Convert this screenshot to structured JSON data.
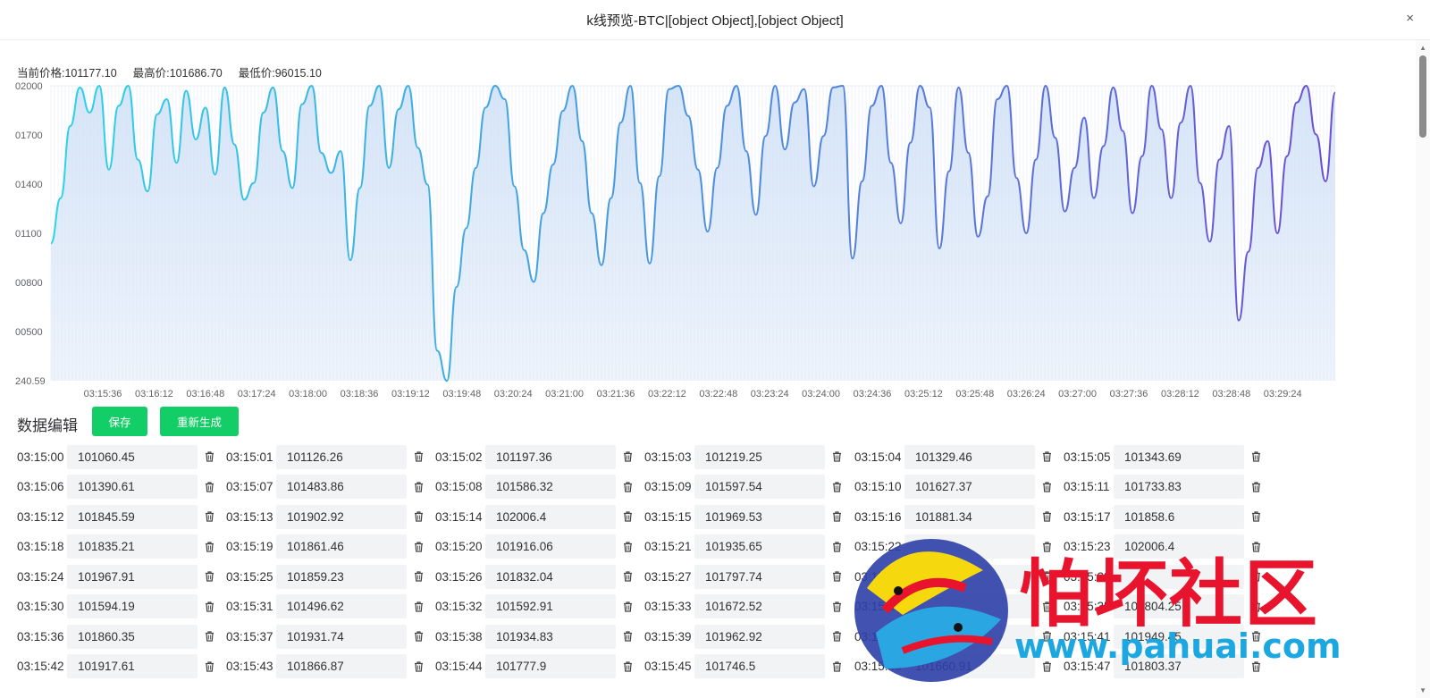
{
  "window": {
    "title": "k线预览-BTC|[object Object],[object Object]",
    "close_label": "×"
  },
  "stats": [
    {
      "label": "当前价格:",
      "value": "101177.10"
    },
    {
      "label": "最高价:",
      "value": "101686.70"
    },
    {
      "label": "最低价:",
      "value": "96015.10"
    }
  ],
  "chart_data": {
    "type": "area",
    "y_ticks": [
      "02000",
      "01700",
      "01400",
      "01100",
      "00800",
      "00500",
      "240.59"
    ],
    "ylim": [
      100240.59,
      102000
    ],
    "x_ticks": [
      "03:15:36",
      "03:16:12",
      "03:16:48",
      "03:17:24",
      "03:18:00",
      "03:18:36",
      "03:19:12",
      "03:19:48",
      "03:20:24",
      "03:21:00",
      "03:21:36",
      "03:22:12",
      "03:22:48",
      "03:23:24",
      "03:24:00",
      "03:24:36",
      "03:25:12",
      "03:25:48",
      "03:26:24",
      "03:27:00",
      "03:27:36",
      "03:28:12",
      "03:28:48",
      "03:29:24"
    ],
    "xlim": [
      "03:15:00",
      "03:29:59"
    ],
    "grid": true,
    "colors": {
      "start": "#2bd4e8",
      "end": "#6b4fd8",
      "fill": "#cfe0f6"
    },
    "series": [
      {
        "values": [
          101060,
          101330,
          101760,
          101990,
          101840,
          102000,
          101500,
          101880,
          102000,
          101560,
          101370,
          101830,
          101920,
          101540,
          101970,
          101680,
          101870,
          101470,
          101990,
          101650,
          101320,
          101420,
          101840,
          101990,
          101610,
          101390,
          101890,
          102000,
          101600,
          101480,
          101610,
          100960,
          101390,
          101880,
          102000,
          101510,
          101860,
          102000,
          101630,
          101410,
          100420,
          100240,
          100800,
          101150,
          101510,
          101870,
          102000,
          101920,
          101400,
          101020,
          100830,
          101240,
          101530,
          101850,
          102000,
          101670,
          101240,
          100930,
          101330,
          101780,
          102000,
          101420,
          100940,
          101460,
          101980,
          102000,
          101820,
          101500,
          101130,
          101510,
          101880,
          102000,
          101610,
          101230,
          101700,
          102000,
          101620,
          101900,
          101980,
          101400,
          101700,
          101990,
          102000,
          100970,
          101430,
          101880,
          102000,
          101540,
          101180,
          101660,
          102000,
          101870,
          101030,
          101490,
          101990,
          101600,
          101100,
          101340,
          101920,
          102000,
          101450,
          101120,
          101560,
          102000,
          101690,
          101250,
          101510,
          101810,
          101330,
          101640,
          101990,
          101730,
          101240,
          101580,
          102000,
          101740,
          101330,
          101780,
          102000,
          101420,
          101070,
          101560,
          101760,
          100600,
          101010,
          101510,
          101670,
          101120,
          101580,
          101900,
          102000,
          101710,
          101430,
          101960
        ]
      }
    ]
  },
  "section": {
    "title": "数据编辑",
    "save_label": "保存",
    "regenerate_label": "重新生成"
  },
  "rows": [
    [
      {
        "time": "03:15:00",
        "value": "101060.45"
      },
      {
        "time": "03:15:01",
        "value": "101126.26"
      },
      {
        "time": "03:15:02",
        "value": "101197.36"
      },
      {
        "time": "03:15:03",
        "value": "101219.25"
      },
      {
        "time": "03:15:04",
        "value": "101329.46"
      },
      {
        "time": "03:15:05",
        "value": "101343.69"
      }
    ],
    [
      {
        "time": "03:15:06",
        "value": "101390.61"
      },
      {
        "time": "03:15:07",
        "value": "101483.86"
      },
      {
        "time": "03:15:08",
        "value": "101586.32"
      },
      {
        "time": "03:15:09",
        "value": "101597.54"
      },
      {
        "time": "03:15:10",
        "value": "101627.37"
      },
      {
        "time": "03:15:11",
        "value": "101733.83"
      }
    ],
    [
      {
        "time": "03:15:12",
        "value": "101845.59"
      },
      {
        "time": "03:15:13",
        "value": "101902.92"
      },
      {
        "time": "03:15:14",
        "value": "102006.4"
      },
      {
        "time": "03:15:15",
        "value": "101969.53"
      },
      {
        "time": "03:15:16",
        "value": "101881.34"
      },
      {
        "time": "03:15:17",
        "value": "101858.6"
      }
    ],
    [
      {
        "time": "03:15:18",
        "value": "101835.21"
      },
      {
        "time": "03:15:19",
        "value": "101861.46"
      },
      {
        "time": "03:15:20",
        "value": "101916.06"
      },
      {
        "time": "03:15:21",
        "value": "101935.65"
      },
      {
        "time": "03:15:22",
        "value": ""
      },
      {
        "time": "03:15:23",
        "value": "102006.4"
      }
    ],
    [
      {
        "time": "03:15:24",
        "value": "101967.91"
      },
      {
        "time": "03:15:25",
        "value": "101859.23"
      },
      {
        "time": "03:15:26",
        "value": "101832.04"
      },
      {
        "time": "03:15:27",
        "value": "101797.74"
      },
      {
        "time": "03:15:28",
        "value": ""
      },
      {
        "time": "03:15:29",
        "value": ""
      }
    ],
    [
      {
        "time": "03:15:30",
        "value": "101594.19"
      },
      {
        "time": "03:15:31",
        "value": "101496.62"
      },
      {
        "time": "03:15:32",
        "value": "101592.91"
      },
      {
        "time": "03:15:33",
        "value": "101672.52"
      },
      {
        "time": "03:15:34",
        "value": ""
      },
      {
        "time": "03:15:35",
        "value": "101804.25"
      }
    ],
    [
      {
        "time": "03:15:36",
        "value": "101860.35"
      },
      {
        "time": "03:15:37",
        "value": "101931.74"
      },
      {
        "time": "03:15:38",
        "value": "101934.83"
      },
      {
        "time": "03:15:39",
        "value": "101962.92"
      },
      {
        "time": "03:15:40",
        "value": ""
      },
      {
        "time": "03:15:41",
        "value": "101949.45"
      }
    ],
    [
      {
        "time": "03:15:42",
        "value": "101917.61"
      },
      {
        "time": "03:15:43",
        "value": "101866.87"
      },
      {
        "time": "03:15:44",
        "value": "101777.9"
      },
      {
        "time": "03:15:45",
        "value": "101746.5"
      },
      {
        "time": "03:15:46",
        "value": "101660.91"
      },
      {
        "time": "03:15:47",
        "value": "101803.37"
      }
    ]
  ],
  "watermark": {
    "brand_name": "怕坏社区",
    "url": "www.pahuai.com"
  }
}
